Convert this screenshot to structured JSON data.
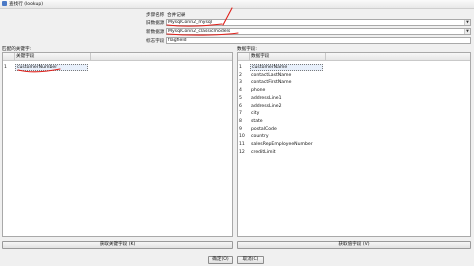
{
  "window": {
    "title": "查找行 (lookup)"
  },
  "form": {
    "step_name_label": "步骤名称",
    "step_name_value": "合并记录",
    "old_source_label": "旧数据源",
    "old_source_value": "MysqlConn2_mysql",
    "new_source_label": "新数据源",
    "new_source_value": "MysqlConn2_classicmodels",
    "flag_field_label": "标志字段",
    "flag_field_value": "flagfield"
  },
  "left_panel": {
    "section_label": "匹配的关键字:",
    "column_header": "关键字段",
    "rows": [
      {
        "num": "1",
        "field": "customerNumber"
      }
    ],
    "get_button_label": "获取关键字段 (K)"
  },
  "right_panel": {
    "section_label": "数据字段:",
    "column_header": "数据字段",
    "rows": [
      {
        "num": "1",
        "field": "customerName"
      },
      {
        "num": "2",
        "field": "contactLastName"
      },
      {
        "num": "3",
        "field": "contactFirstName"
      },
      {
        "num": "4",
        "field": "phone"
      },
      {
        "num": "5",
        "field": "addressLine1"
      },
      {
        "num": "6",
        "field": "addressLine2"
      },
      {
        "num": "7",
        "field": "city"
      },
      {
        "num": "8",
        "field": "state"
      },
      {
        "num": "9",
        "field": "postalCode"
      },
      {
        "num": "10",
        "field": "country"
      },
      {
        "num": "11",
        "field": "salesRepEmployeeNumber"
      },
      {
        "num": "12",
        "field": "creditLimit"
      }
    ],
    "get_button_label": "获取值字段 (V)"
  },
  "dialog_buttons": {
    "ok_label": "确定(O)",
    "cancel_label": "取消(C)"
  },
  "colors": {
    "annotation": "#e0201a",
    "selection": "#e8f0fb"
  }
}
